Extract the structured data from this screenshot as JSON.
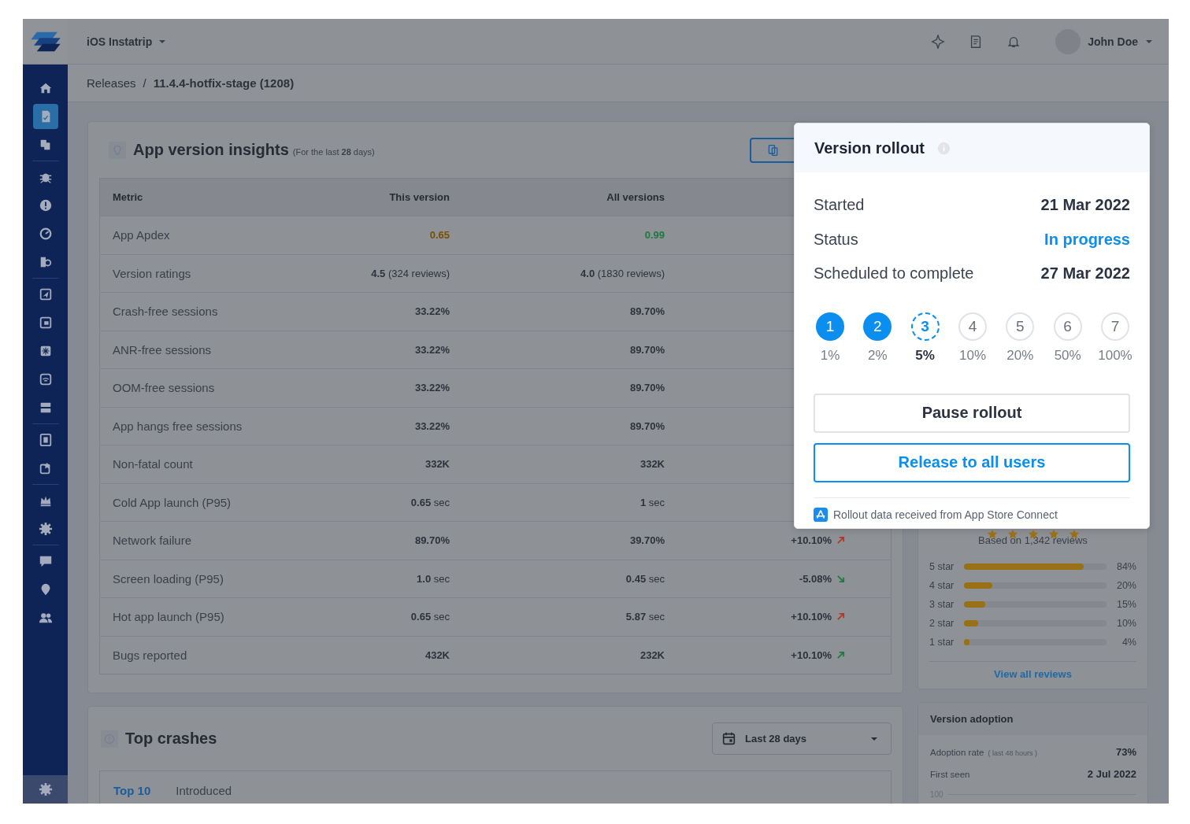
{
  "top_bar": {
    "platform": "iOS",
    "app_name": "Instatrip",
    "user_name": "John Doe"
  },
  "sidebar": {
    "groups": [
      {
        "items": [
          {
            "selected": false
          },
          {
            "selected": true
          },
          {
            "selected": false
          }
        ]
      },
      {
        "items": [
          {
            "selected": false
          },
          {
            "selected": false
          },
          {
            "selected": false
          },
          {
            "selected": false
          }
        ]
      },
      {
        "items": [
          {
            "selected": false
          },
          {
            "selected": false
          },
          {
            "selected": false
          },
          {
            "selected": false
          },
          {
            "selected": false
          }
        ]
      },
      {
        "items": [
          {
            "selected": false
          },
          {
            "selected": false
          }
        ]
      },
      {
        "items": [
          {
            "selected": false
          },
          {
            "selected": false
          }
        ]
      },
      {
        "items": [
          {
            "selected": false
          },
          {
            "selected": false
          },
          {
            "selected": false
          }
        ]
      }
    ]
  },
  "breadcrumb": {
    "items": [
      "Releases",
      "11.4.4-hotfix-stage (1208)"
    ],
    "separator": "/"
  },
  "insights": {
    "title": "App version insights",
    "subtitle": "(For the last **28** days)",
    "columns": [
      "Metric",
      "This version",
      "All versions"
    ],
    "rows": [
      {
        "metric": "App Apdex",
        "kind": "bold",
        "this_version": {
          "text": "0.65",
          "color": "#7a5000"
        },
        "all_versions": {
          "text": "0.99",
          "color": "#1e7a3e"
        }
      },
      {
        "metric": "Version ratings",
        "kind": "mixed",
        "this_version": {
          "text": "**4.5** (324 reviews)"
        },
        "all_versions": {
          "text": "**4.0** (1830 reviews)"
        }
      },
      {
        "metric": "Crash-free sessions",
        "kind": "bold",
        "this_version": {
          "text": "33.22%"
        },
        "all_versions": {
          "text": "89.70%"
        }
      },
      {
        "metric": "ANR-free sessions",
        "kind": "bold",
        "this_version": {
          "text": "33.22%"
        },
        "all_versions": {
          "text": "89.70%"
        }
      },
      {
        "metric": "OOM-free sessions",
        "kind": "bold",
        "this_version": {
          "text": "33.22%"
        },
        "all_versions": {
          "text": "89.70%"
        }
      },
      {
        "metric": "App hangs free sessions",
        "kind": "bold",
        "this_version": {
          "text": "33.22%"
        },
        "all_versions": {
          "text": "89.70%"
        }
      },
      {
        "metric": "Non-fatal count",
        "kind": "bold",
        "this_version": {
          "text": "332K"
        },
        "all_versions": {
          "text": "332K"
        }
      },
      {
        "metric": "Cold App launch (P95)",
        "kind": "mixed",
        "this_version": {
          "text": "**0.65** sec"
        },
        "all_versions": {
          "text": "**1** sec"
        }
      },
      {
        "metric": "Network failure",
        "kind": "bold",
        "this_version": {
          "text": "89.70%"
        },
        "all_versions": {
          "text": "39.70%"
        },
        "change": {
          "text": "+10.10%",
          "rising": true,
          "color": "#b03a26"
        }
      },
      {
        "metric": "Screen loading (P95)",
        "kind": "mixed",
        "this_version": {
          "text": "**1.0** sec"
        },
        "all_versions": {
          "text": "**0.45** sec"
        },
        "change": {
          "text": "-5.08%",
          "rising": false,
          "color": "#1e7a3e"
        }
      },
      {
        "metric": "Hot app launch (P95)",
        "kind": "mixed",
        "this_version": {
          "text": "**0.65** sec"
        },
        "all_versions": {
          "text": "**5.87** sec"
        },
        "change": {
          "text": "+10.10%",
          "rising": true,
          "color": "#b03a26"
        }
      },
      {
        "metric": "Bugs reported",
        "kind": "bold",
        "this_version": {
          "text": "432K"
        },
        "all_versions": {
          "text": "232K"
        },
        "change": {
          "text": "+10.10%",
          "rising": true,
          "color": "#1e7a3e"
        }
      }
    ]
  },
  "top_crashes": {
    "title": "Top crashes",
    "period": "Last 28 days",
    "tabs": [
      {
        "label": "Top 10",
        "selected": true
      },
      {
        "label": "Introduced",
        "selected": false
      }
    ]
  },
  "ratings": {
    "summary": "Based on 1,342 reviews",
    "bars": [
      {
        "label": "5 star",
        "level": 0.84,
        "reading": "84%"
      },
      {
        "label": "4 star",
        "level": 0.2,
        "reading": "20%"
      },
      {
        "label": "3 star",
        "level": 0.15,
        "reading": "15%"
      },
      {
        "label": "2 star",
        "level": 0.1,
        "reading": "10%"
      },
      {
        "label": "1 star",
        "level": 0.04,
        "reading": "4%"
      }
    ],
    "link": "View all reviews"
  },
  "adoption": {
    "title": "Version adoption",
    "rows": [
      {
        "label": "Adoption rate",
        "note": "( last 48 hours )",
        "value": "73%"
      },
      {
        "label": "First seen",
        "value": "2 Jul 2022"
      }
    ],
    "axis_label": "100"
  },
  "rollout": {
    "title": "Version rollout",
    "details": [
      {
        "label": "Started",
        "value": "21 Mar 2022",
        "highlighted": false
      },
      {
        "label": "Status",
        "value": "In progress",
        "highlighted": true
      },
      {
        "label": "Scheduled to complete",
        "value": "27 Mar 2022",
        "highlighted": false
      }
    ],
    "steps": [
      {
        "number": "1",
        "percent": "1%",
        "done": true,
        "current": false
      },
      {
        "number": "2",
        "percent": "2%",
        "done": true,
        "current": false
      },
      {
        "number": "3",
        "percent": "5%",
        "done": false,
        "current": true
      },
      {
        "number": "4",
        "percent": "10%",
        "done": false,
        "current": false
      },
      {
        "number": "5",
        "percent": "20%",
        "done": false,
        "current": false
      },
      {
        "number": "6",
        "percent": "50%",
        "done": false,
        "current": false
      },
      {
        "number": "7",
        "percent": "100%",
        "done": false,
        "current": false
      }
    ],
    "buttons": [
      {
        "label": "Pause rollout",
        "kind": "secondary"
      },
      {
        "label": "Release to all users",
        "kind": "primary"
      }
    ],
    "source": "Rollout data received from App Store Connect"
  }
}
